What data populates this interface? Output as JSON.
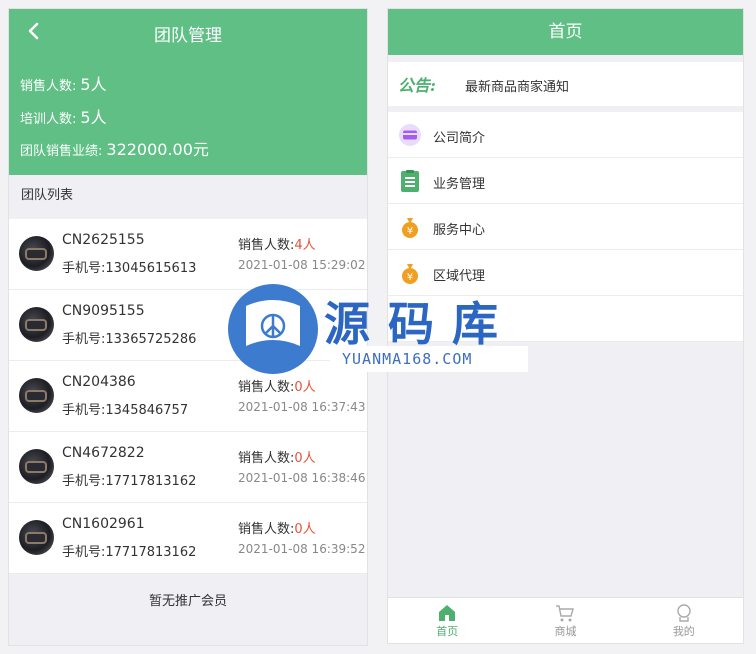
{
  "left": {
    "title": "团队管理",
    "stats": [
      {
        "label": "销售人数:",
        "value": "5人"
      },
      {
        "label": "培训人数:",
        "value": "5人"
      },
      {
        "label": "团队销售业绩:",
        "value": "322000.00元"
      }
    ],
    "list_label": "团队列表",
    "members": [
      {
        "code": "CN2625155",
        "phone_label": "手机号:",
        "phone": "13045615613",
        "sales_label": "销售人数:",
        "sales": "4人",
        "time": "2021-01-08 15:29:02"
      },
      {
        "code": "CN9095155",
        "phone_label": "手机号:",
        "phone": "13365725286",
        "sales_label": "销售人数:",
        "sales": "",
        "time": ""
      },
      {
        "code": "CN204386",
        "phone_label": "手机号:",
        "phone": "1345846757",
        "sales_label": "销售人数:",
        "sales": "0人",
        "time": "2021-01-08 16:37:43"
      },
      {
        "code": "CN4672822",
        "phone_label": "手机号:",
        "phone": "17717813162",
        "sales_label": "销售人数:",
        "sales": "0人",
        "time": "2021-01-08 16:38:46"
      },
      {
        "code": "CN1602961",
        "phone_label": "手机号:",
        "phone": "17717813162",
        "sales_label": "销售人数:",
        "sales": "0人",
        "time": "2021-01-08 16:39:52"
      }
    ],
    "empty_text": "暂无推广会员"
  },
  "right": {
    "title": "首页",
    "notice_tag": "公告:",
    "notice_text": "最新商品商家通知",
    "menu": [
      {
        "label": "公司简介",
        "icon": "card-icon",
        "color": "#a25cf0"
      },
      {
        "label": "业务管理",
        "icon": "clipboard-icon",
        "color": "#4faf6f"
      },
      {
        "label": "服务中心",
        "icon": "money-bag-icon",
        "color": "#f0a020"
      },
      {
        "label": "区域代理",
        "icon": "money-bag-icon",
        "color": "#f0a020"
      },
      {
        "label": "",
        "icon": "",
        "color": ""
      }
    ],
    "tabs": [
      {
        "label": "首页",
        "icon": "home-icon",
        "active": true
      },
      {
        "label": "商城",
        "icon": "cart-icon",
        "active": false
      },
      {
        "label": "我的",
        "icon": "user-icon",
        "active": false
      }
    ]
  },
  "watermark": {
    "chars": "源码库",
    "latin": "YUANMA168.COM"
  },
  "colors": {
    "primary": "#5fbf85",
    "accent_red": "#e4533b"
  }
}
